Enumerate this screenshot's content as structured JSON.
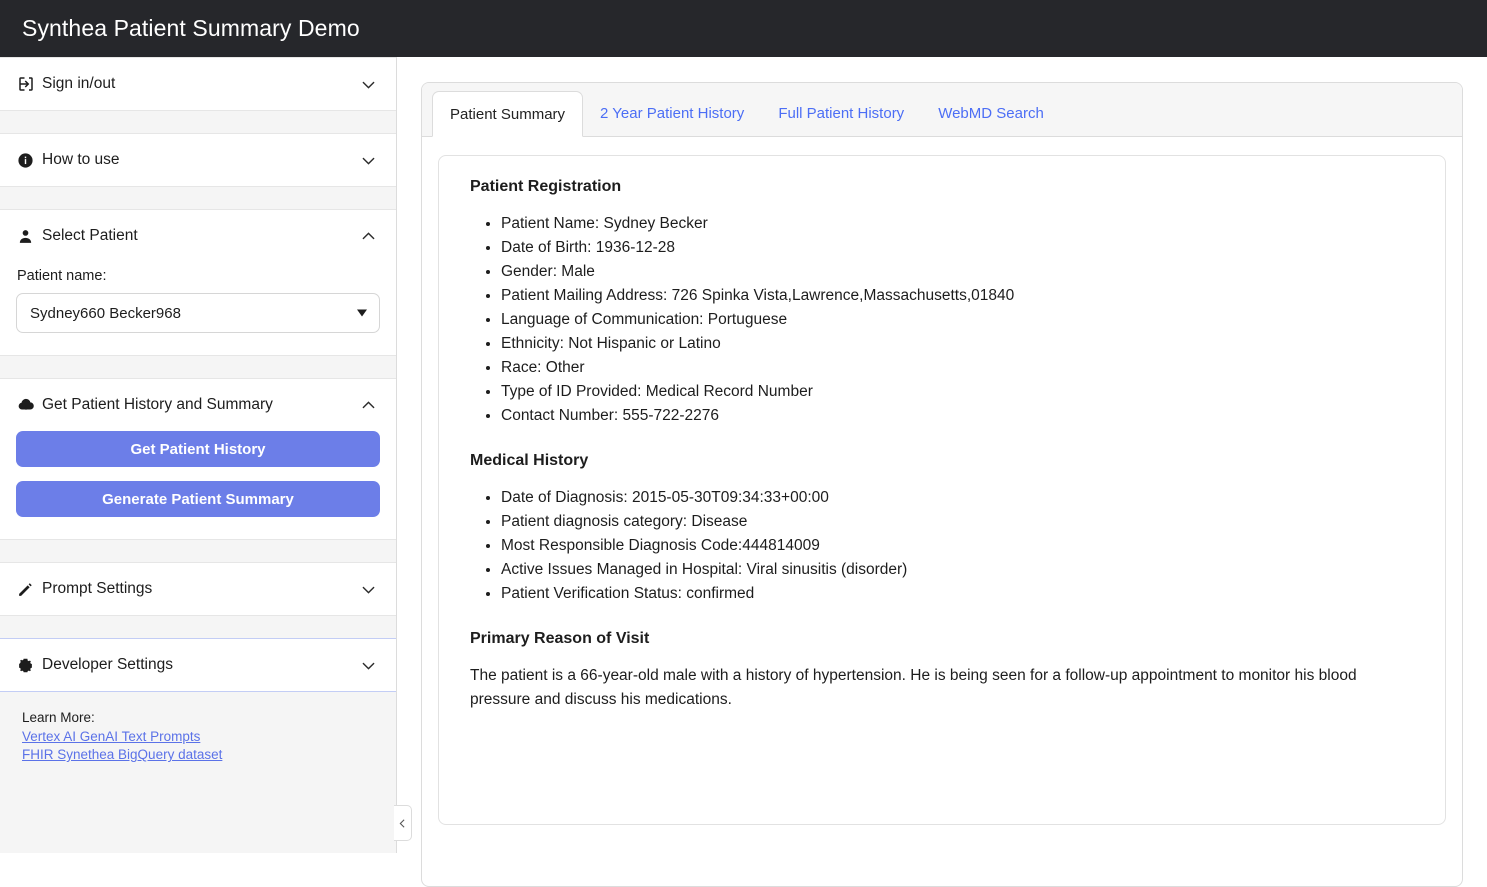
{
  "header": {
    "title": "Synthea Patient Summary Demo"
  },
  "sidebar": {
    "sections": [
      {
        "id": "sign-in-out",
        "label": "Sign in/out",
        "icon": "login-icon",
        "expanded": false
      },
      {
        "id": "how-to-use",
        "label": "How to use",
        "icon": "info-icon",
        "expanded": false
      },
      {
        "id": "select-patient",
        "label": "Select Patient",
        "icon": "person-icon",
        "expanded": true
      },
      {
        "id": "get-patient-history-and-summary",
        "label": "Get Patient History and Summary",
        "icon": "cloud-download-icon",
        "expanded": true
      },
      {
        "id": "prompt-settings",
        "label": "Prompt Settings",
        "icon": "pencil-icon",
        "expanded": false
      },
      {
        "id": "developer-settings",
        "label": "Developer Settings",
        "icon": "gear-icon",
        "expanded": false
      }
    ],
    "select_patient": {
      "field_label": "Patient name:",
      "selected_value": "Sydney660 Becker968"
    },
    "actions": {
      "get_history_label": "Get Patient History",
      "generate_summary_label": "Generate Patient Summary"
    },
    "learn_more": {
      "title": "Learn More:",
      "links": [
        "Vertex AI GenAI Text Prompts",
        "FHIR Synethea BigQuery dataset"
      ]
    },
    "collapse_icon": "chevron-left-icon"
  },
  "main": {
    "tabs": [
      {
        "label": "Patient Summary",
        "active": true
      },
      {
        "label": "2 Year Patient History",
        "active": false
      },
      {
        "label": "Full Patient History",
        "active": false
      },
      {
        "label": "WebMD Search",
        "active": false
      }
    ],
    "summary": {
      "registration_title": "Patient Registration",
      "registration_items": [
        "Patient Name: Sydney Becker",
        "Date of Birth: 1936-12-28",
        "Gender: Male",
        "Patient Mailing Address: 726 Spinka Vista,Lawrence,Massachusetts,01840",
        "Language of Communication: Portuguese",
        "Ethnicity: Not Hispanic or Latino",
        "Race: Other",
        "Type of ID Provided: Medical Record Number",
        "Contact Number: 555-722-2276"
      ],
      "medical_history_title": "Medical History",
      "medical_history_items": [
        "Date of Diagnosis: 2015-05-30T09:34:33+00:00",
        "Patient diagnosis category: Disease",
        "Most Responsible Diagnosis Code:444814009",
        "Active Issues Managed in Hospital: Viral sinusitis (disorder)",
        "Patient Verification Status: confirmed"
      ],
      "reason_title": "Primary Reason of Visit",
      "reason_text": "The patient is a 66-year-old male with a history of hypertension. He is being seen for a follow-up appointment to monitor his blood pressure and discuss his medications."
    }
  },
  "colors": {
    "header_bg": "#26272b",
    "accent_button": "#6c7ee8",
    "link": "#4c6ef5",
    "sidebar_bg": "#f5f5f5"
  }
}
